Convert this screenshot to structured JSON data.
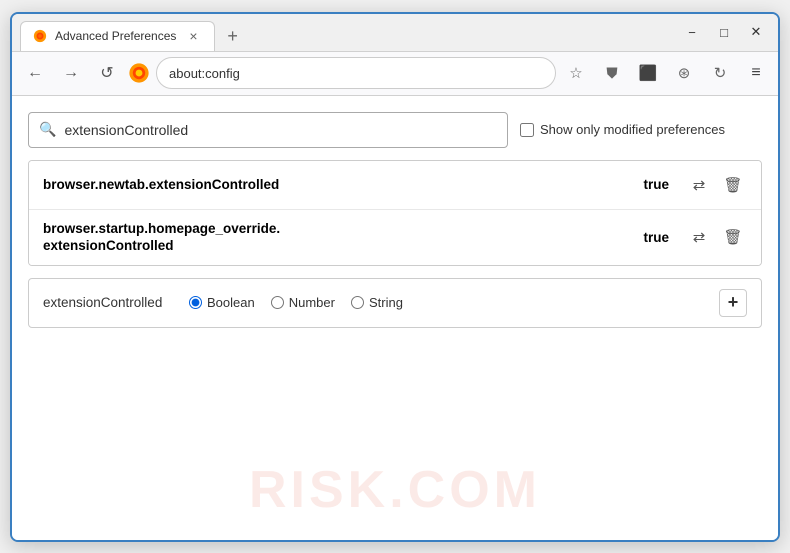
{
  "window": {
    "title": "Advanced Preferences",
    "tab_close": "×",
    "new_tab": "+",
    "min": "−",
    "max": "□",
    "close": "✕"
  },
  "nav": {
    "back": "←",
    "forward": "→",
    "reload": "↺",
    "browser_name": "Firefox",
    "address": "about:config",
    "bookmark_icon": "☆",
    "shield_icon": "⛊",
    "extension_icon": "⬛",
    "profile_icon": "⊛",
    "sync_icon": "↻",
    "menu_icon": "≡"
  },
  "search": {
    "placeholder": "extensionControlled",
    "value": "extensionControlled",
    "show_modified_label": "Show only modified preferences"
  },
  "results": [
    {
      "name": "browser.newtab.extensionControlled",
      "value": "true"
    },
    {
      "name": "browser.startup.homepage_override.\nextensionControlled",
      "name_line1": "browser.startup.homepage_override.",
      "name_line2": "extensionControlled",
      "value": "true",
      "multiline": true
    }
  ],
  "new_pref": {
    "name": "extensionControlled",
    "types": [
      "Boolean",
      "Number",
      "String"
    ],
    "selected_type": "Boolean",
    "add_label": "+"
  },
  "watermark": "RISK.COM",
  "colors": {
    "accent_blue": "#0060df",
    "border": "#3a7fc1"
  }
}
